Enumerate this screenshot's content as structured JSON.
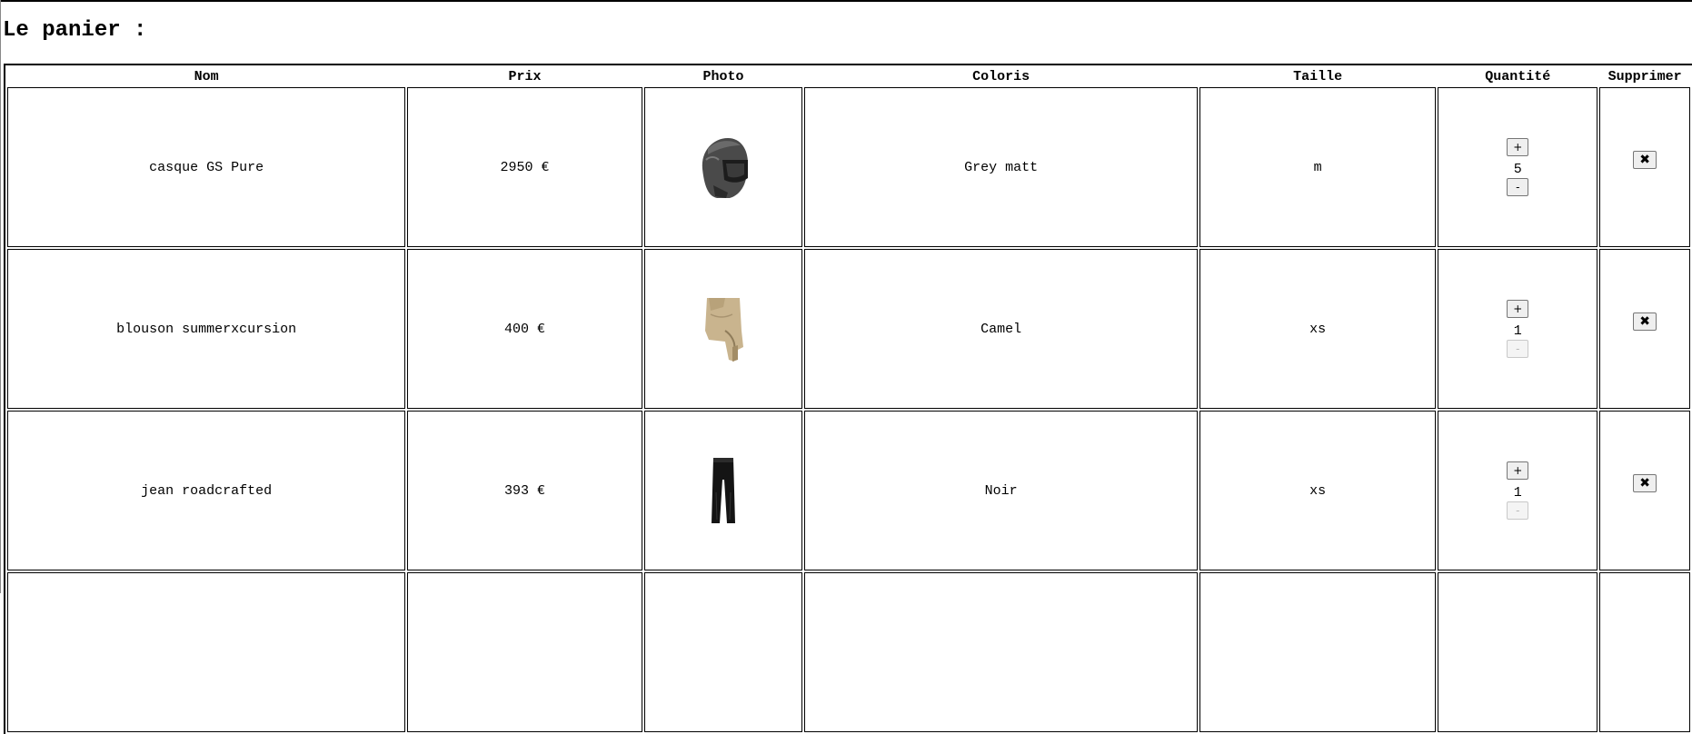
{
  "page": {
    "title": "Le panier :"
  },
  "table": {
    "headers": {
      "name": "Nom",
      "price": "Prix",
      "photo": "Photo",
      "color": "Coloris",
      "size": "Taille",
      "quantity": "Quantité",
      "delete": "Supprimer"
    },
    "rows": [
      {
        "name": "casque GS Pure",
        "price": "2950 €",
        "photo_icon": "helmet-photo",
        "color": "Grey matt",
        "size": "m",
        "quantity": "5",
        "minus_enabled": true,
        "plus_label": "+",
        "minus_label": "-",
        "delete_label": "✖"
      },
      {
        "name": "blouson summerxcursion",
        "price": "400 €",
        "photo_icon": "jacket-photo",
        "color": "Camel",
        "size": "xs",
        "quantity": "1",
        "minus_enabled": false,
        "plus_label": "+",
        "minus_label": "-",
        "delete_label": "✖"
      },
      {
        "name": "jean roadcrafted",
        "price": "393 €",
        "photo_icon": "jeans-photo",
        "color": "Noir",
        "size": "xs",
        "quantity": "1",
        "minus_enabled": false,
        "plus_label": "+",
        "minus_label": "-",
        "delete_label": "✖"
      }
    ]
  }
}
